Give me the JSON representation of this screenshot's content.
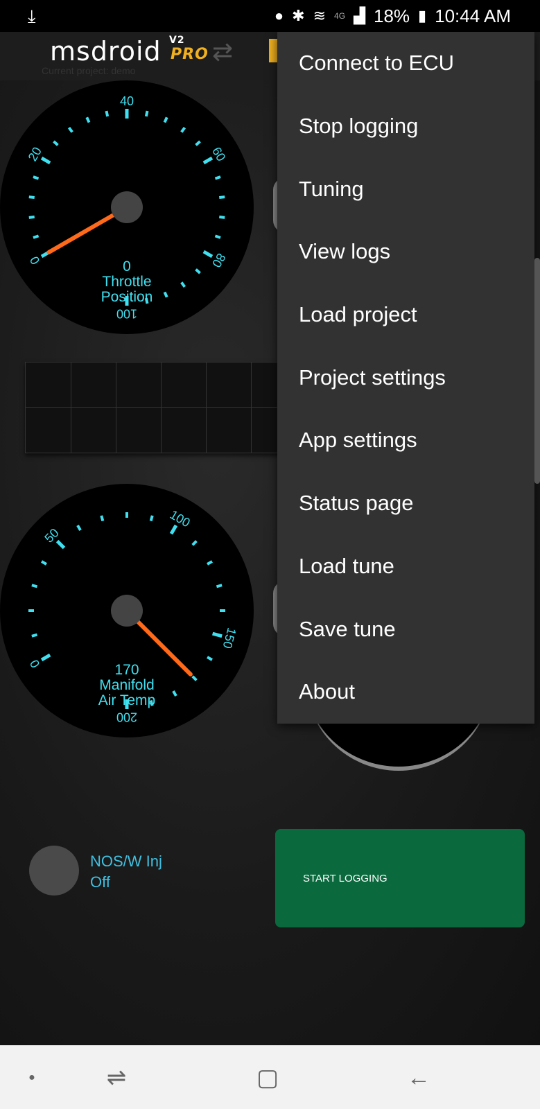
{
  "status_bar": {
    "download_icon": "download-icon",
    "network_label": "4G",
    "battery": "18%",
    "time": "10:44 AM"
  },
  "header": {
    "logo_text": "msdroid",
    "logo_version": "V2",
    "logo_edition": "PRO",
    "current_project": "Current project: demo"
  },
  "gauges": [
    {
      "value": "0",
      "label_line1": "Throttle",
      "label_line2": "Position",
      "ticks": [
        "0",
        "20",
        "40",
        "60",
        "80",
        "100"
      ],
      "reading_value": 0
    },
    {
      "value": "170",
      "label_line1": "Manifold",
      "label_line2": "Air Temp",
      "ticks": [
        "0",
        "50",
        "100",
        "150",
        "200"
      ],
      "reading_value": 170
    }
  ],
  "nos": {
    "label_line1": "NOS/W Inj",
    "label_line2": "Off"
  },
  "start_logging_label": "START LOGGING",
  "menu": {
    "items": [
      "Connect to ECU",
      "Stop logging",
      "Tuning",
      "View logs",
      "Load project",
      "Project settings",
      "App settings",
      "Status page",
      "Load tune",
      "Save tune",
      "About"
    ]
  },
  "colors": {
    "gauge_text": "#40e0f0",
    "needle": "#ff6a1a",
    "start_button": "#0a6a3e",
    "menu_bg": "#323232",
    "logo_accent": "#f0b020"
  },
  "navbar": {
    "recent_icon": "recent-apps-icon",
    "home_icon": "home-icon",
    "back_icon": "back-icon",
    "dot_icon": "dot-icon"
  }
}
